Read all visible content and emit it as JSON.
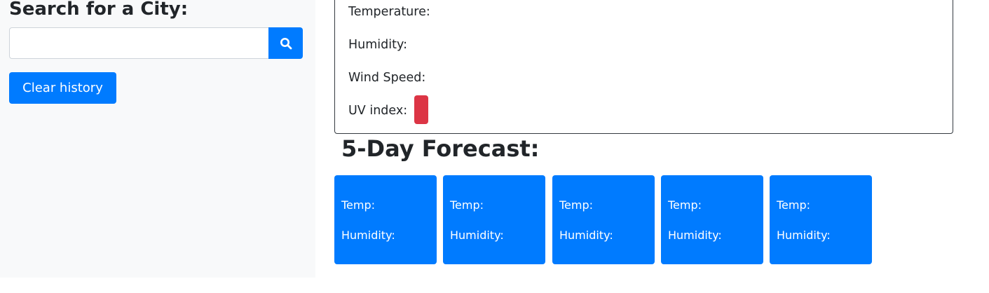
{
  "sidebar": {
    "heading": "Search for a City:",
    "search_value": "",
    "search_placeholder": "",
    "search_icon": "search-icon",
    "clear_label": "Clear history"
  },
  "current": {
    "temperature_label": "Temperature:",
    "humidity_label": "Humidity:",
    "wind_label": "Wind Speed:",
    "uv_label": "UV index:",
    "uv_value": ""
  },
  "forecast": {
    "title": "5-Day Forecast:",
    "days": [
      {
        "temp_label": "Temp:",
        "humidity_label": "Humidity:"
      },
      {
        "temp_label": "Temp:",
        "humidity_label": "Humidity:"
      },
      {
        "temp_label": "Temp:",
        "humidity_label": "Humidity:"
      },
      {
        "temp_label": "Temp:",
        "humidity_label": "Humidity:"
      },
      {
        "temp_label": "Temp:",
        "humidity_label": "Humidity:"
      }
    ]
  },
  "colors": {
    "primary": "#007bff",
    "danger": "#dc3545",
    "sidebar_bg": "#f8f9fa"
  }
}
